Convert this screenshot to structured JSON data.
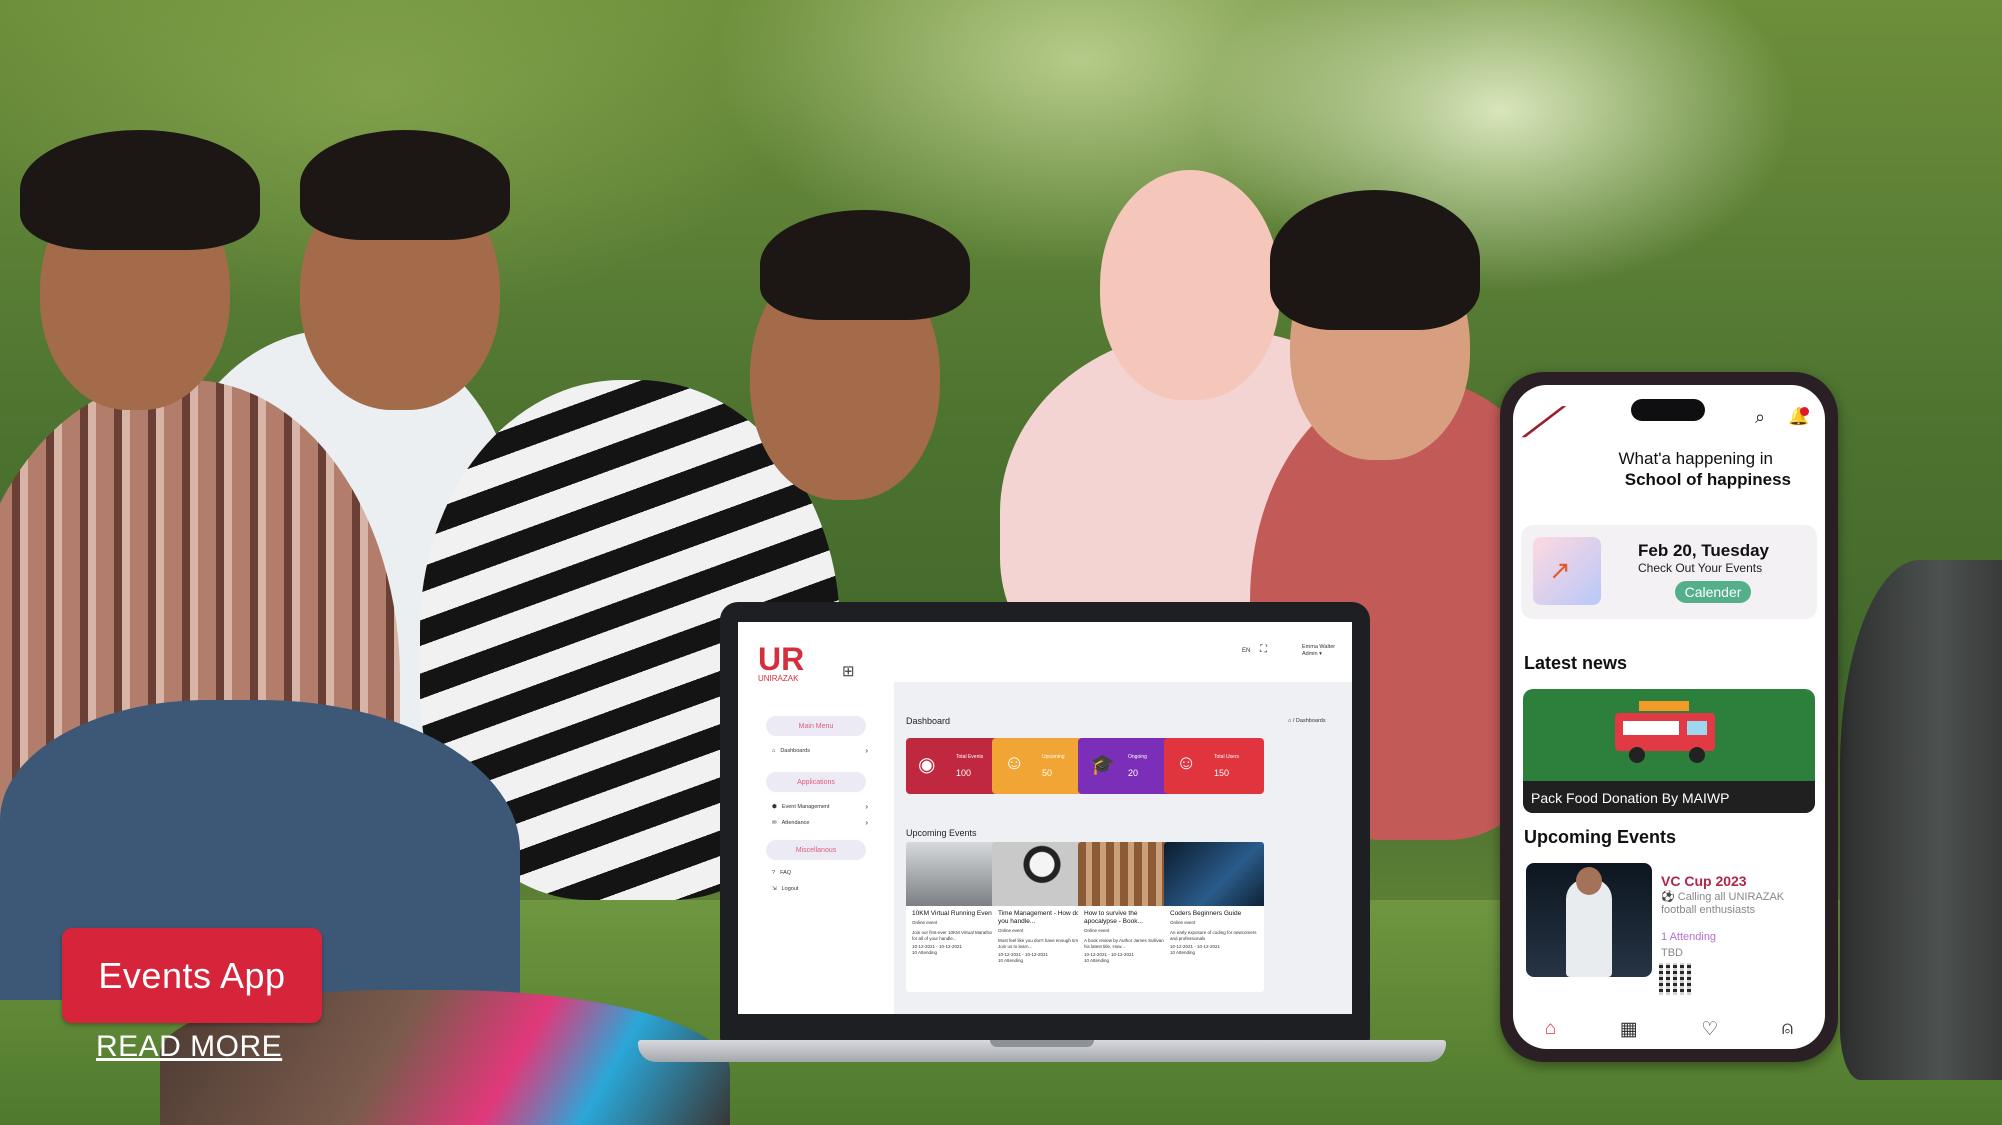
{
  "promo": {
    "button_label": "Events App",
    "link_label": "READ MORE"
  },
  "dashboard": {
    "brand": "UR",
    "brand_sub": "UNIRAZAK",
    "sidebar": {
      "main_menu": "Main Menu",
      "dashboards": "Dashboards",
      "applications": "Applications",
      "event_management": "Event Management",
      "attendance": "Attendance",
      "miscellaneous": "Miscellanous",
      "faq": "FAQ",
      "logout": "Logout"
    },
    "topbar": {
      "lang": "EN",
      "user_name": "Emma Walter",
      "user_role": "Admin ▾"
    },
    "title": "Dashboard",
    "breadcrumb": "/ Dashboards",
    "stats": [
      {
        "label": "Total Events",
        "value": "100",
        "color": "#c0283f"
      },
      {
        "label": "Upcoming",
        "value": "50",
        "color": "#f0a534"
      },
      {
        "label": "Ongoing",
        "value": "20",
        "color": "#7b2fb8"
      },
      {
        "label": "Total Users",
        "value": "150",
        "color": "#e0343f"
      }
    ],
    "upcoming_title": "Upcoming Events",
    "events": [
      {
        "title": "10KM Virtual Running Event",
        "type": "Online event",
        "desc": "Join our first-ever 10KM Virtual Marathon for all of your handle...",
        "date": "10-12-2021 - 10-12-2021",
        "attending": "10 Attending"
      },
      {
        "title": "Time Management - How do you handle...",
        "type": "Online event",
        "desc": "Most feel like you don't have enough time? Join us to learn...",
        "date": "10-12-2021 - 10-12-2021",
        "attending": "10 Attending"
      },
      {
        "title": "How to survive the apocalypse - Book...",
        "type": "Online event",
        "desc": "A book review by Author James Sullivan on his latest title, How...",
        "date": "10-12-2021 - 10-12-2021",
        "attending": "10 Attending"
      },
      {
        "title": "Coders Beginners Guide",
        "type": "Online event",
        "desc": "An early exposure of coding for newcomers and professionals",
        "date": "10-12-2021 - 10-12-2021",
        "attending": "10 Attending"
      }
    ]
  },
  "mobile": {
    "heading_line1": "What'a happening in",
    "heading_line2": "School of happiness",
    "date": "Feb 20, Tuesday",
    "check_out": "Check Out Your Events",
    "calendar_button": "Calender",
    "latest_news": "Latest news",
    "news_caption": "Pack Food Donation By MAIWP",
    "upcoming_events": "Upcoming Events",
    "event_title": "VC Cup 2023",
    "event_desc": "⚽ Calling all UNIRAZAK football enthusiasts",
    "event_attending": "1 Attending",
    "event_when": "TBD"
  }
}
